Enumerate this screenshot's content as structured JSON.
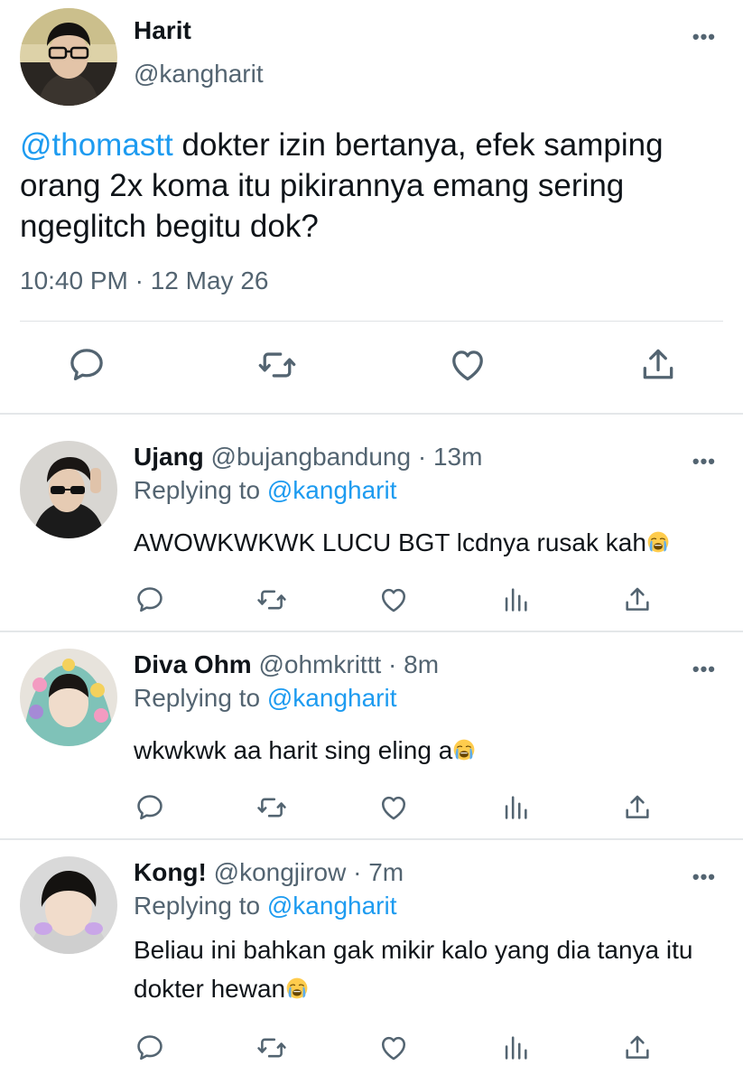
{
  "main_tweet": {
    "author_name": "Harit",
    "author_handle": "@kangharit",
    "mention": "@thomastt",
    "text": " dokter izin bertanya, efek samping orang 2x koma itu pikirannya emang sering ngeglitch begitu dok?",
    "timestamp": "10:40 PM · 12 May 26",
    "more": "•••"
  },
  "replies": [
    {
      "name": "Ujang",
      "meta": " @bujangbandung · 13m",
      "replying_prefix": "Replying to ",
      "replying_handle": "@kangharit",
      "text": "AWOWKWKWK LUCU BGT lcdnya rusak kah",
      "emoji": "loudly-crying-face",
      "more": "•••"
    },
    {
      "name": "Diva Ohm",
      "meta": " @ohmkrittt · 8m",
      "replying_prefix": "Replying to ",
      "replying_handle": "@kangharit",
      "text": "wkwkwk aa harit sing eling a",
      "emoji": "loudly-crying-face",
      "more": "•••"
    },
    {
      "name": "Kong!",
      "meta": " @kongjirow · 7m",
      "replying_prefix": "Replying to ",
      "replying_handle": "@kangharit",
      "text": "Beliau ini bahkan gak mikir kalo yang dia tanya itu dokter hewan",
      "emoji": "loudly-crying-face",
      "more": "•••"
    }
  ],
  "icons": {
    "main_actions": [
      "reply-icon",
      "retweet-icon",
      "like-icon",
      "share-icon"
    ],
    "reply_actions": [
      "reply-icon",
      "retweet-icon",
      "like-icon",
      "analytics-icon",
      "share-icon"
    ]
  },
  "colors": {
    "link": "#1d9bf0",
    "secondary_text": "#536471",
    "primary_text": "#0f1419",
    "divider": "#e4e7e9"
  }
}
